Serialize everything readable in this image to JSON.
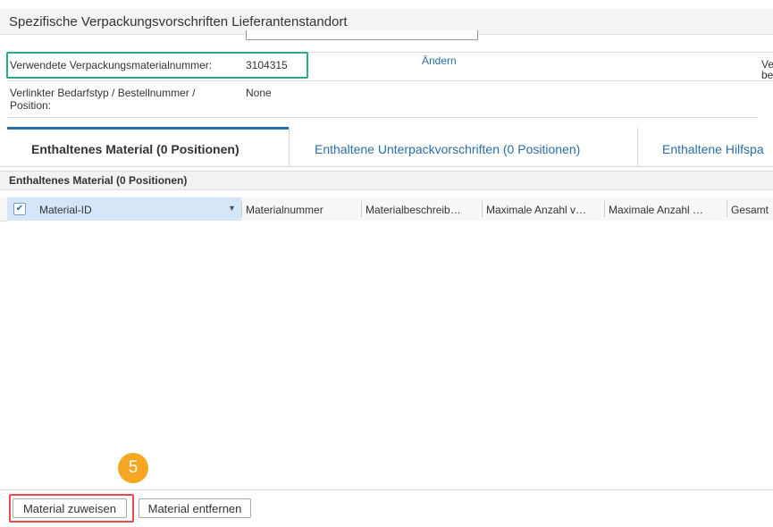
{
  "window": {
    "title": "Spezifische Verpackungsvorschriften Lieferantenstandort"
  },
  "fields": {
    "packaging_material_label": "Verwendete Verpackungsmaterialnummer:",
    "packaging_material_value": "3104315",
    "change_link": "Ändern",
    "truncated_right_label_line1": "Ve",
    "truncated_right_label_line2": "be",
    "linked_demand_label_line1": "Verlinkter Bedarfstyp / Bestellnummer /",
    "linked_demand_label_line2": "Position:",
    "linked_demand_value": "None"
  },
  "tabs": [
    {
      "label": "Enthaltenes Material (0 Positionen)",
      "active": true
    },
    {
      "label": "Enthaltene Unterpackvorschriften (0 Positionen)",
      "active": false
    },
    {
      "label": "Enthaltene Hilfspa",
      "active": false
    }
  ],
  "section": {
    "title": "Enthaltenes Material (0 Positionen)"
  },
  "grid": {
    "select_all_checked": true,
    "columns": [
      "Material-ID",
      "Materialnummer",
      "Materialbeschreib…",
      "Maximale Anzahl v…",
      "Maximale Anzahl …",
      "Gesamt"
    ]
  },
  "footer": {
    "assign_button": "Material zuweisen",
    "remove_button": "Material entfernen"
  },
  "callout": {
    "step_number": "5",
    "color": "#f5a623"
  },
  "colors": {
    "accent": "#2a6ea6",
    "highlight_green": "#29a98b",
    "highlight_red": "#e44b4b"
  },
  "icons": {
    "checkbox": "check-icon",
    "column_menu": "caret-down-icon"
  }
}
